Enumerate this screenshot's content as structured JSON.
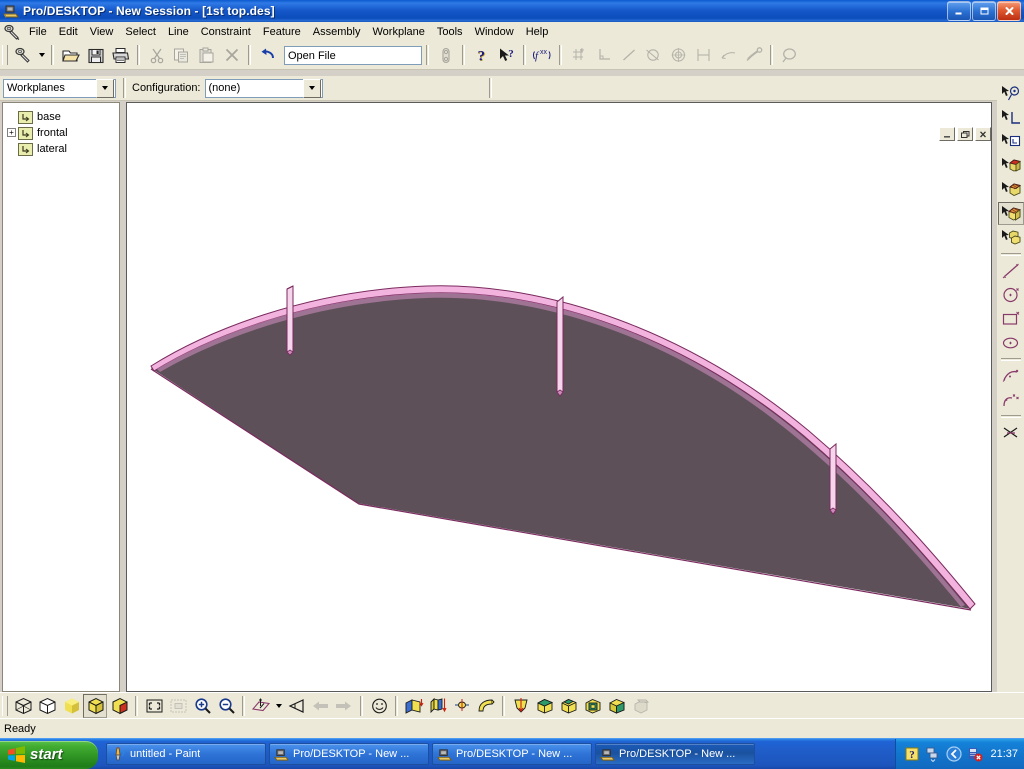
{
  "window": {
    "title": "Pro/DESKTOP  - New Session - [1st top.des]",
    "app_icon": "prodesktop-icon",
    "minimize_label": "_",
    "maximize_label": "❐",
    "close_label": "✕"
  },
  "mdi": {
    "minimize_label": "_",
    "restore_label": "❐",
    "close_label": "✕"
  },
  "menu": {
    "items": [
      {
        "label": "File"
      },
      {
        "label": "Edit"
      },
      {
        "label": "View"
      },
      {
        "label": "Select"
      },
      {
        "label": "Line"
      },
      {
        "label": "Constraint"
      },
      {
        "label": "Feature"
      },
      {
        "label": "Assembly"
      },
      {
        "label": "Workplane"
      },
      {
        "label": "Tools"
      },
      {
        "label": "Window"
      },
      {
        "label": "Help"
      }
    ]
  },
  "toolbar_main": {
    "buttons": [
      {
        "name": "new-design-button",
        "icon": "pro-desktop-pencil-icon",
        "enabled": true
      },
      {
        "name": "new-design-dropdown",
        "icon": "chevron-down-icon",
        "enabled": true
      },
      {
        "name": "open-button",
        "icon": "folder-open-icon",
        "enabled": true
      },
      {
        "name": "save-button",
        "icon": "floppy-disk-icon",
        "enabled": true
      },
      {
        "name": "print-button",
        "icon": "printer-icon",
        "enabled": true
      },
      {
        "name": "cut-button",
        "icon": "scissors-icon",
        "enabled": false
      },
      {
        "name": "copy-button",
        "icon": "copy-icon",
        "enabled": false
      },
      {
        "name": "paste-button",
        "icon": "clipboard-paste-icon",
        "enabled": false
      },
      {
        "name": "delete-button",
        "icon": "delete-x-icon",
        "enabled": false
      },
      {
        "name": "undo-button",
        "icon": "undo-arrow-icon",
        "enabled": true
      }
    ],
    "openfile_value": "Open File",
    "right_buttons": [
      {
        "name": "properties-button",
        "icon": "chain-link-icon",
        "enabled": false
      },
      {
        "name": "help-button",
        "icon": "question-mark-icon",
        "enabled": true
      },
      {
        "name": "context-help-button",
        "icon": "arrow-question-icon",
        "enabled": true
      },
      {
        "name": "variables-button",
        "icon": "function-xx-icon",
        "enabled": true
      },
      {
        "name": "add-constraint-button",
        "icon": "crosshair-plus-icon",
        "enabled": false
      },
      {
        "name": "perpendicular-constraint-button",
        "icon": "perpendicular-icon",
        "enabled": false
      },
      {
        "name": "line-constraint-button",
        "icon": "diagonal-line-icon",
        "enabled": false
      },
      {
        "name": "tangent-constraint-button",
        "icon": "tangent-circle-icon",
        "enabled": false
      },
      {
        "name": "concentric-constraint-button",
        "icon": "concentric-circles-icon",
        "enabled": false
      },
      {
        "name": "equal-constraint-button",
        "icon": "equal-length-icon",
        "enabled": false
      },
      {
        "name": "parallel-constraint-button",
        "icon": "parallel-icon",
        "enabled": false
      },
      {
        "name": "fix-constraint-button",
        "icon": "anchor-pin-icon",
        "enabled": false
      },
      {
        "name": "zoom-tool-button",
        "icon": "magnifier-icon",
        "enabled": false
      }
    ]
  },
  "toolbar_config": {
    "workplanes_value": "Workplanes",
    "configuration_label": "Configuration:",
    "configuration_value": "(none)"
  },
  "tree": {
    "items": [
      {
        "label": "base",
        "icon": "workplane-icon",
        "expandable": false,
        "expanded": false
      },
      {
        "label": "frontal",
        "icon": "workplane-icon",
        "expandable": true,
        "expanded": false,
        "expander_glyph": "+"
      },
      {
        "label": "lateral",
        "icon": "workplane-icon",
        "expandable": false,
        "expanded": false
      }
    ]
  },
  "toolbar_right": {
    "buttons": [
      {
        "name": "select-point-tool",
        "icon": "select-point-icon",
        "active": false
      },
      {
        "name": "select-line-tool",
        "icon": "select-line-icon",
        "active": false
      },
      {
        "name": "select-workplane-tool",
        "icon": "select-workplane-icon",
        "active": false
      },
      {
        "name": "select-face-tool",
        "icon": "select-face-icon",
        "active": false
      },
      {
        "name": "select-feature-tool",
        "icon": "select-feature-icon",
        "active": false
      },
      {
        "name": "select-part-tool",
        "icon": "select-part-icon",
        "active": true
      },
      {
        "name": "select-assembly-tool",
        "icon": "select-assembly-icon",
        "active": false
      },
      {
        "name": "line-tool",
        "icon": "straight-line-icon",
        "active": false
      },
      {
        "name": "circle-tool",
        "icon": "circle-icon",
        "active": false
      },
      {
        "name": "rectangle-tool",
        "icon": "rectangle-icon",
        "active": false
      },
      {
        "name": "ellipse-tool",
        "icon": "ellipse-icon",
        "active": false
      },
      {
        "name": "arc-tool",
        "icon": "arc-icon",
        "active": false
      },
      {
        "name": "spline-tool",
        "icon": "spline-icon",
        "active": false
      },
      {
        "name": "trim-tool",
        "icon": "scissors-trim-icon",
        "active": false
      }
    ]
  },
  "toolbar_bottom": {
    "buttons": [
      {
        "name": "wireframe-view-button",
        "icon": "wireframe-cube-icon",
        "active": false,
        "enabled": true
      },
      {
        "name": "hidden-line-view-button",
        "icon": "hidden-line-cube-icon",
        "active": false,
        "enabled": true
      },
      {
        "name": "shaded-no-edges-button",
        "icon": "shaded-yellow-cube-icon",
        "active": false,
        "enabled": true
      },
      {
        "name": "shaded-with-edges-button",
        "icon": "shaded-edges-cube-icon",
        "active": true,
        "enabled": true
      },
      {
        "name": "transparent-view-button",
        "icon": "transparent-cube-icon",
        "active": false,
        "enabled": true
      },
      {
        "name": "zoom-fit-button",
        "icon": "zoom-fit-icon",
        "active": false,
        "enabled": true
      },
      {
        "name": "zoom-selection-button",
        "icon": "zoom-selection-icon",
        "active": false,
        "enabled": false
      },
      {
        "name": "zoom-in-button",
        "icon": "zoom-in-icon",
        "active": false,
        "enabled": true
      },
      {
        "name": "zoom-out-button",
        "icon": "zoom-out-icon",
        "active": false,
        "enabled": true
      },
      {
        "name": "view-orientation-button",
        "icon": "view-plane-icon",
        "active": false,
        "enabled": true
      },
      {
        "name": "view-orientation-dropdown",
        "icon": "chevron-down-icon",
        "active": false,
        "enabled": true
      },
      {
        "name": "camera-view-button",
        "icon": "eye-camera-icon",
        "active": false,
        "enabled": true
      },
      {
        "name": "previous-view-button",
        "icon": "arrow-left-icon",
        "active": false,
        "enabled": false
      },
      {
        "name": "next-view-button",
        "icon": "arrow-right-icon",
        "active": false,
        "enabled": false
      },
      {
        "name": "render-button",
        "icon": "smiley-render-icon",
        "active": false,
        "enabled": true
      },
      {
        "name": "extrude-button",
        "icon": "extrude-icon",
        "active": false,
        "enabled": true
      },
      {
        "name": "revolve-button",
        "icon": "revolve-icon",
        "active": false,
        "enabled": true
      },
      {
        "name": "sweep-button",
        "icon": "sweep-icon",
        "active": false,
        "enabled": true
      },
      {
        "name": "loft-button",
        "icon": "loft-icon",
        "active": false,
        "enabled": true
      },
      {
        "name": "project-profile-button",
        "icon": "project-profile-icon",
        "active": false,
        "enabled": true
      },
      {
        "name": "round-edges-button",
        "icon": "round-edges-cube-icon",
        "active": false,
        "enabled": true
      },
      {
        "name": "chamfer-edges-button",
        "icon": "chamfer-edges-cube-icon",
        "active": false,
        "enabled": true
      },
      {
        "name": "shell-solid-button",
        "icon": "shell-cube-icon",
        "active": false,
        "enabled": true
      },
      {
        "name": "draft-faces-button",
        "icon": "draft-faces-cube-icon",
        "active": false,
        "enabled": true
      },
      {
        "name": "material-button",
        "icon": "material-icon",
        "active": false,
        "enabled": false
      }
    ]
  },
  "statusbar": {
    "text": "Ready"
  },
  "taskbar": {
    "start_label": "start",
    "items": [
      {
        "label": "untitled - Paint",
        "icon": "paint-icon",
        "active": false
      },
      {
        "label": "Pro/DESKTOP - New ...",
        "icon": "prodesktop-icon",
        "active": false
      },
      {
        "label": "Pro/DESKTOP - New ...",
        "icon": "prodesktop-icon",
        "active": false
      },
      {
        "label": "Pro/DESKTOP - New ...",
        "icon": "prodesktop-icon",
        "active": true
      }
    ],
    "tray": [
      {
        "name": "help-tray-icon",
        "icon": "question-yellow-icon"
      },
      {
        "name": "network-tray-icon",
        "icon": "network-icon"
      },
      {
        "name": "media-tray-icon",
        "icon": "media-player-icon"
      },
      {
        "name": "volume-tray-icon",
        "icon": "volume-error-icon"
      }
    ],
    "clock": "21:37"
  },
  "model": {
    "name": "1st top.des",
    "surface_color": "#5e5059",
    "edge_highlight_color": "#f2b4df",
    "edge_outline_color": "#7a2a5e",
    "background_color": "#ffffff",
    "description": "Shaded 3D wing / hydrofoil solid with three thin vertical slots"
  },
  "colors": {
    "title_blue": "#0b4dbb",
    "face_gray": "#ece9d8",
    "taskbar_blue": "#1f63d6",
    "start_green": "#2f9424",
    "accent_pink": "#f2b4df"
  }
}
